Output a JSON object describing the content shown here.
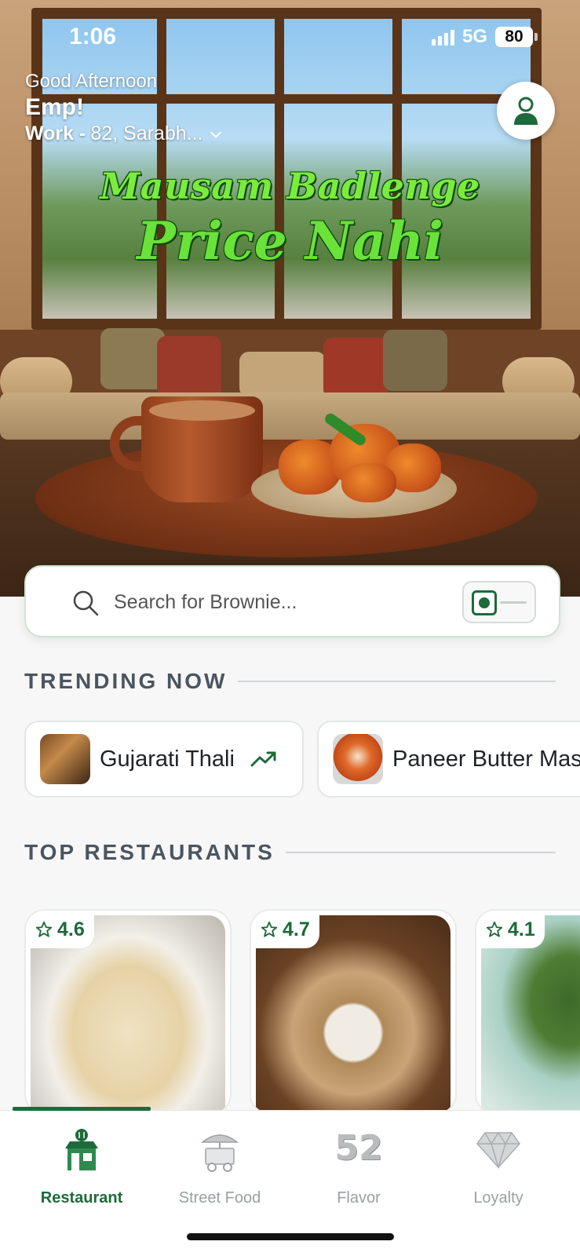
{
  "status_bar": {
    "time": "1:06",
    "network": "5G",
    "battery": "80"
  },
  "header": {
    "greeting": "Good Afternoon",
    "name": "Emp!",
    "address_label": "Work -",
    "address": "82, Sarabh...",
    "profile_icon": "user-icon"
  },
  "banner": {
    "line1": "Mausam Badlenge",
    "line2": "Price Nahi"
  },
  "search": {
    "placeholder": "Search for Brownie...",
    "veg_toggle": "veg-only-toggle"
  },
  "trending": {
    "title": "TRENDING NOW",
    "items": [
      {
        "label": "Gujarati Thali",
        "icon": "trending-up-icon"
      },
      {
        "label": "Paneer Butter Masala"
      }
    ]
  },
  "restaurants": {
    "title": "TOP RESTAURANTS",
    "items": [
      {
        "rating": "4.6",
        "image": "pasta"
      },
      {
        "rating": "4.7",
        "image": "momos"
      },
      {
        "rating": "4.1",
        "image": "hara-bhara-kebab"
      }
    ]
  },
  "bottom_nav": {
    "items": [
      {
        "label": "Restaurant",
        "icon": "restaurant-icon",
        "active": true
      },
      {
        "label": "Street Food",
        "icon": "food-cart-icon"
      },
      {
        "label": "Flavor",
        "icon": "52",
        "icon_name": "flavor-52-icon"
      },
      {
        "label": "Loyalty",
        "icon": "diamond-icon"
      }
    ]
  },
  "colors": {
    "brand_green": "#1d6a3a",
    "banner_green": "#6ae23a",
    "inactive": "#9aa0a2"
  }
}
